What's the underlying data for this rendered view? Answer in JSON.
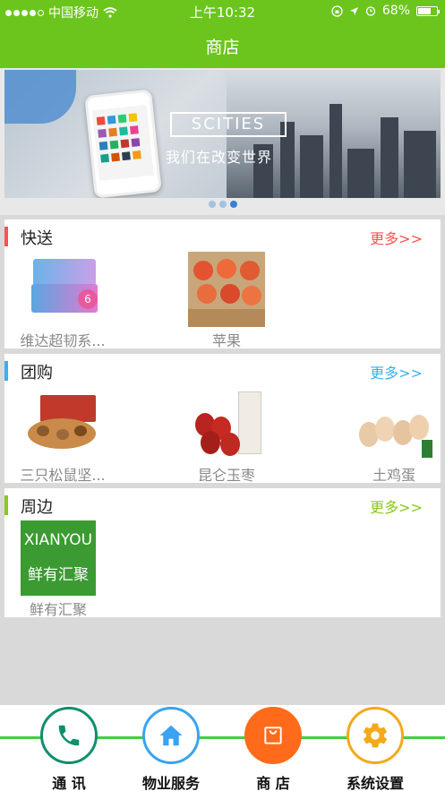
{
  "status_bar": {
    "carrier": "中国移动",
    "time": "上午10:32",
    "battery": "68%"
  },
  "header": {
    "title": "商店"
  },
  "banner": {
    "logo_text": "SCITIES",
    "slogan": "我们在改变世界",
    "pages": 3,
    "active_page": 3
  },
  "sections": [
    {
      "title": "快送",
      "more": "更多>>",
      "accent": "#ff5252",
      "items": [
        {
          "label": "维达超韧系..."
        },
        {
          "label": "苹果"
        }
      ]
    },
    {
      "title": "团购",
      "more": "更多>>",
      "accent": "#36b2f0",
      "items": [
        {
          "label": "三只松鼠坚..."
        },
        {
          "label": "昆仑玉枣"
        },
        {
          "label": "土鸡蛋"
        }
      ]
    },
    {
      "title": "周边",
      "more": "更多>>",
      "accent": "#8cc71b",
      "items": [
        {
          "label": "鲜有汇聚",
          "logo_en": "XIANYOU",
          "logo_cn": "鲜有汇聚"
        }
      ]
    }
  ],
  "tabbar": {
    "tabs": [
      {
        "label": "通 讯",
        "icon": "phone-icon",
        "color": "#0f8f6d"
      },
      {
        "label": "物业服务",
        "icon": "house-icon",
        "color": "#3aa3f1"
      },
      {
        "label": "商 店",
        "icon": "shopping-bag-icon",
        "color": "#ff6b1a"
      },
      {
        "label": "系统设置",
        "icon": "gear-icon",
        "color": "#f2a91a"
      }
    ]
  }
}
